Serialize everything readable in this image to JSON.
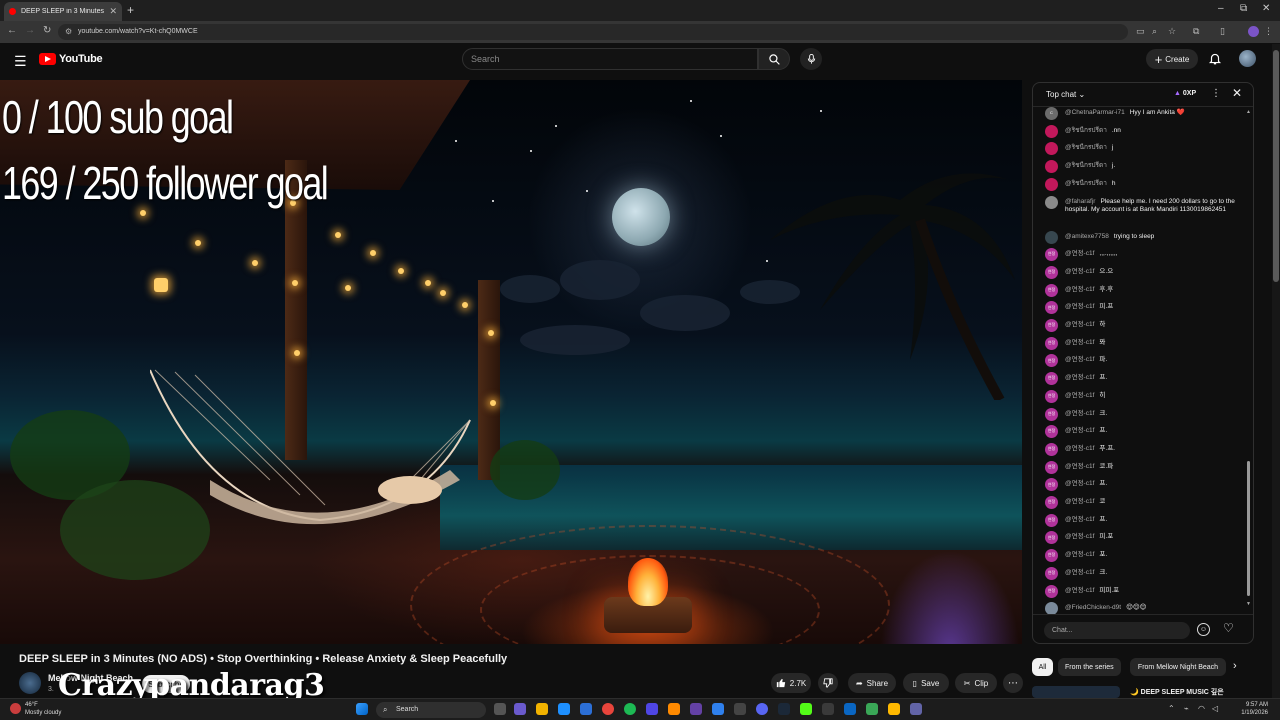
{
  "browser": {
    "tab_title": "DEEP SLEEP in 3 Minutes (NO ADS)",
    "url": "youtube.com/watch?v=Kt-chQ0MWCE",
    "new_tab_glyph": "+",
    "win_min": "–",
    "win_max": "⧉",
    "win_close": "✕"
  },
  "youtube": {
    "logo_text": "YouTube",
    "search_placeholder": "Search",
    "create_label": "Create"
  },
  "video": {
    "overlay_line1": "0 / 100 sub goal",
    "overlay_line2": "169 / 250 follower goal",
    "title": "DEEP SLEEP in 3 Minutes (NO ADS) • Stop Overthinking • Release Anxiety & Sleep Peacefully",
    "channel": "Mellow Night Beach",
    "subs": "3.",
    "subscribe_label": "Subscribe",
    "watermark": "Crazypandarag3",
    "likes": "2.7K",
    "share_label": "Share",
    "save_label": "Save",
    "clip_label": "Clip"
  },
  "chat": {
    "header": "Top chat",
    "xp": "0XP",
    "input_placeholder": "Chat...",
    "messages": [
      {
        "author": "@ChetnaParmar-i71",
        "text": "Hyy I am Ankita ❤️",
        "color": "#6b6b6b",
        "initial": "C"
      },
      {
        "author": "@ริชนีกรปรีดา",
        "text": ".nn",
        "color": "#c2185b",
        "initial": ""
      },
      {
        "author": "@ริชนีกรปรีดา",
        "text": "j",
        "color": "#c2185b",
        "initial": ""
      },
      {
        "author": "@ริชนีกรปรีดา",
        "text": "j.",
        "color": "#c2185b",
        "initial": ""
      },
      {
        "author": "@ริชนีกรปรีดา",
        "text": "h",
        "color": "#c2185b",
        "initial": ""
      },
      {
        "author": "@faharafjr",
        "text": "Please help me. I need 200 dollars to go to the hospital. My account is at Bank Mandiri 1130019862451",
        "color": "#8a8a8a",
        "initial": ""
      },
      {
        "author": "@amitexe7758",
        "text": "trying to sleep",
        "color": "#37474f",
        "initial": ""
      },
      {
        "author": "@연정-c1f",
        "text": ",,,.,,,,,,",
        "color": "#b0329a",
        "initial": "연정"
      },
      {
        "author": "@연정-c1f",
        "text": "으.으",
        "color": "#b0329a",
        "initial": "연정"
      },
      {
        "author": "@연정-c1f",
        "text": "후.후",
        "color": "#b0329a",
        "initial": "연정"
      },
      {
        "author": "@연정-c1f",
        "text": "피.프",
        "color": "#b0329a",
        "initial": "연정"
      },
      {
        "author": "@연정-c1f",
        "text": "하",
        "color": "#b0329a",
        "initial": "연정"
      },
      {
        "author": "@연정-c1f",
        "text": "퐈",
        "color": "#b0329a",
        "initial": "연정"
      },
      {
        "author": "@연정-c1f",
        "text": "파.",
        "color": "#b0329a",
        "initial": "연정"
      },
      {
        "author": "@연정-c1f",
        "text": "프.",
        "color": "#b0329a",
        "initial": "연정"
      },
      {
        "author": "@연정-c1f",
        "text": "히",
        "color": "#b0329a",
        "initial": "연정"
      },
      {
        "author": "@연정-c1f",
        "text": "크.",
        "color": "#b0329a",
        "initial": "연정"
      },
      {
        "author": "@연정-c1f",
        "text": "프.",
        "color": "#b0329a",
        "initial": "연정"
      },
      {
        "author": "@연정-c1f",
        "text": "푸.프.",
        "color": "#b0329a",
        "initial": "연정"
      },
      {
        "author": "@연정-c1f",
        "text": "코.파",
        "color": "#b0329a",
        "initial": "연정"
      },
      {
        "author": "@연정-c1f",
        "text": "프.",
        "color": "#b0329a",
        "initial": "연정"
      },
      {
        "author": "@연정-c1f",
        "text": "코",
        "color": "#b0329a",
        "initial": "연정"
      },
      {
        "author": "@연정-c1f",
        "text": "프.",
        "color": "#b0329a",
        "initial": "연정"
      },
      {
        "author": "@연정-c1f",
        "text": "피.포",
        "color": "#b0329a",
        "initial": "연정"
      },
      {
        "author": "@연정-c1f",
        "text": "포.",
        "color": "#b0329a",
        "initial": "연정"
      },
      {
        "author": "@연정-c1f",
        "text": "크.",
        "color": "#b0329a",
        "initial": "연정"
      },
      {
        "author": "@연정-c1f",
        "text": "피피.포",
        "color": "#b0329a",
        "initial": "연정"
      },
      {
        "author": "@FriedChicken-d9t",
        "text": "😌😌😌",
        "color": "#7a8a9a",
        "initial": ""
      }
    ]
  },
  "chips": {
    "all": "All",
    "series": "From the series",
    "channel": "From Mellow Night Beach"
  },
  "up_next": {
    "title": "🌙 DEEP SLEEP MUSIC 깊은"
  },
  "taskbar": {
    "temp": "46°F",
    "weather": "Mostly cloudy",
    "search": "Search",
    "time": "9:57 AM",
    "date": "1/19/2026"
  }
}
